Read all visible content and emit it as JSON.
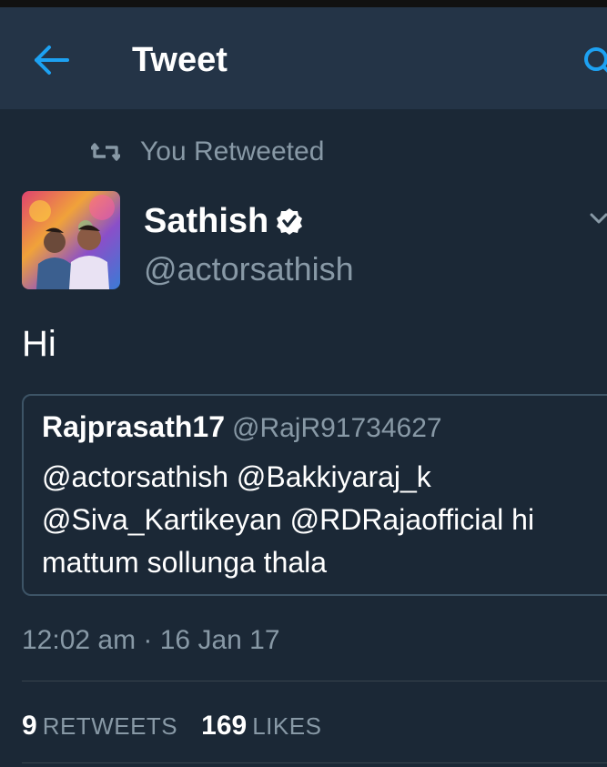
{
  "colors": {
    "background": "#1b2836",
    "app_bar": "#243447",
    "accent": "#1da1f2",
    "secondary_text": "#8899a6",
    "divider": "#38444d"
  },
  "header": {
    "title": "Tweet",
    "back_icon": "arrow-left-icon",
    "search_icon": "search-icon"
  },
  "social_context": {
    "icon": "retweet-icon",
    "text": "You Retweeted"
  },
  "tweet": {
    "author_name": "Sathish",
    "verified_icon": "verified-badge-icon",
    "author_handle": "@actorsathish",
    "text": "Hi",
    "menu_icon": "chevron-down-icon",
    "quoted": {
      "author_name": "Rajprasath17",
      "author_handle": "@RajR91734627",
      "text": "@actorsathish @Bakkiyaraj_k @Siva_Kartikeyan @RDRajaofficial hi mattum sollunga thala"
    },
    "timestamp": "12:02 am · 16 Jan 17",
    "stats": {
      "retweets_count": "9",
      "retweets_label": "RETWEETS",
      "likes_count": "169",
      "likes_label": "LIKES"
    }
  }
}
